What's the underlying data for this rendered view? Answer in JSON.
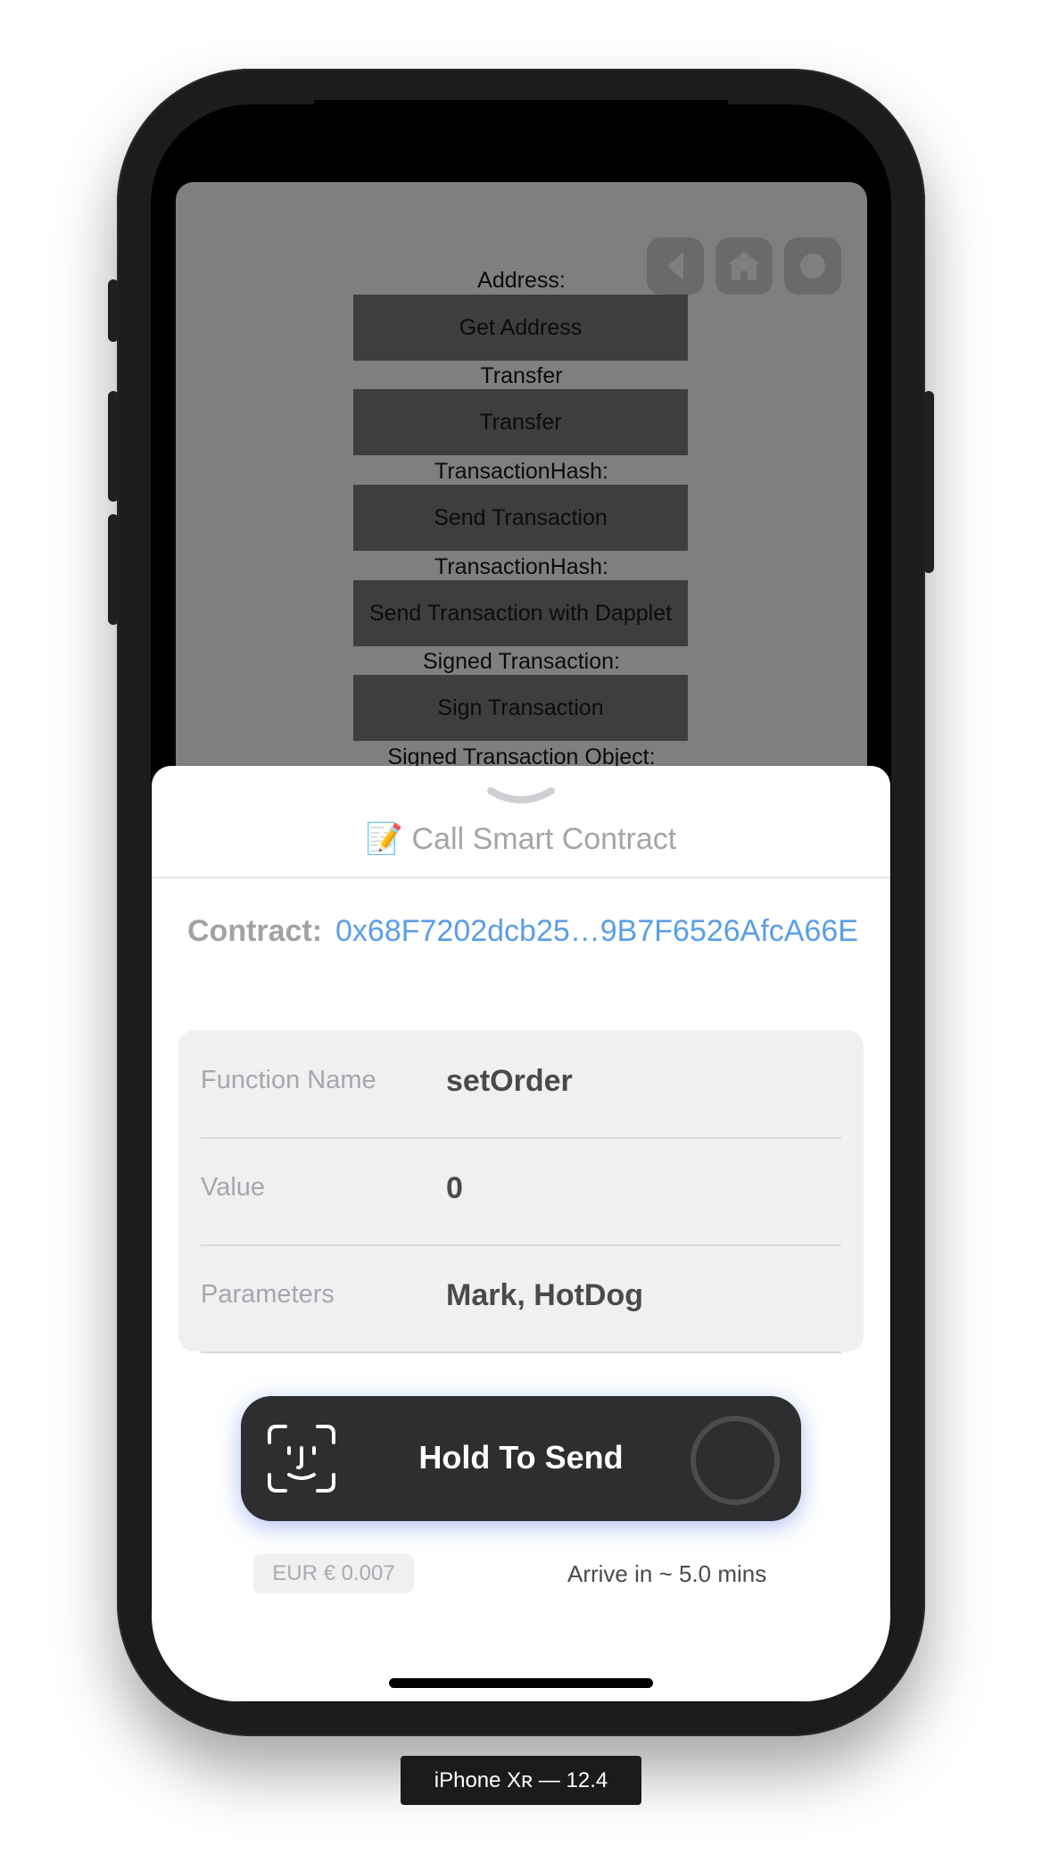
{
  "app": {
    "labels": {
      "address": "Address:",
      "transfer": "Transfer",
      "transaction_hash_1": "TransactionHash:",
      "transaction_hash_2": "TransactionHash:",
      "signed_transaction": "Signed Transaction:",
      "signed_transaction_object": "Signed Transaction Object:"
    },
    "buttons": {
      "get_address": "Get Address",
      "transfer": "Transfer",
      "send_transaction": "Send Transaction",
      "send_transaction_dapplet": "Send Transaction with Dapplet",
      "sign_transaction": "Sign Transaction"
    },
    "nav_icons": [
      "back-icon",
      "home-icon",
      "record-icon"
    ]
  },
  "sheet": {
    "title": "📝 Call Smart Contract",
    "contract_label": "Contract:",
    "contract_value": "0x68F7202dcb25…9B7F6526AfcA66E",
    "rows": [
      {
        "label": "Function Name",
        "value": "setOrder"
      },
      {
        "label": "Value",
        "value": "0"
      },
      {
        "label": "Parameters",
        "value": "Mark, HotDog"
      }
    ],
    "send_button_label": "Hold To Send",
    "fee": "EUR € 0.007",
    "arrive": "Arrive in ~ 5.0 mins"
  },
  "device": {
    "label": "iPhone Xʀ — 12.4"
  },
  "colors": {
    "link": "#5a9ee6",
    "send_button": "#2e2e30",
    "overlay": "#7f7f7f"
  }
}
